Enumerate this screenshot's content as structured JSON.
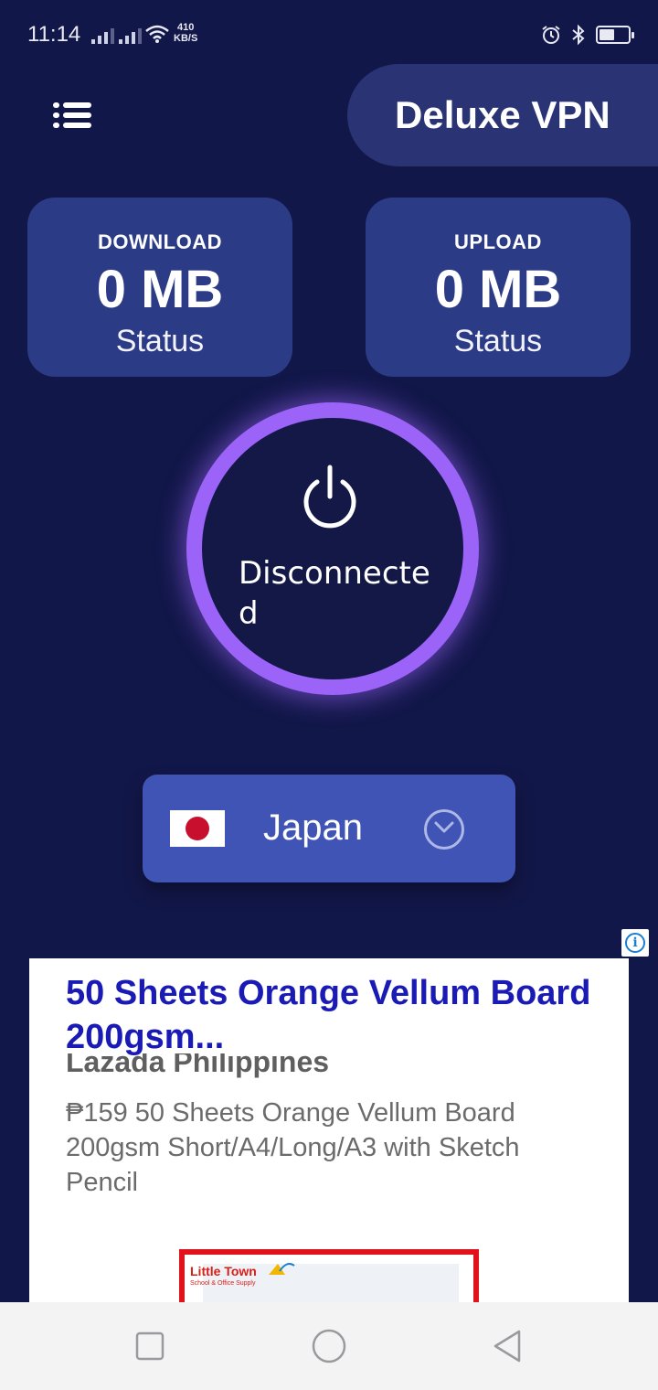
{
  "status_bar": {
    "time": "11:14",
    "net_speed_value": "410",
    "net_speed_unit": "KB/S",
    "icons": [
      "signal-icon",
      "signal-icon",
      "wifi-icon",
      "alarm-icon",
      "bluetooth-icon",
      "battery-icon"
    ],
    "battery_level": 0.45
  },
  "header": {
    "menu_icon": "list-menu-icon",
    "app_title": "Deluxe VPN"
  },
  "stats": {
    "download": {
      "label": "DOWNLOAD",
      "value": "0 MB",
      "status": "Status"
    },
    "upload": {
      "label": "UPLOAD",
      "value": "0 MB",
      "status": "Status"
    }
  },
  "connection": {
    "icon": "power-icon",
    "state": "Disconnected",
    "ring_color": "#9b63f8"
  },
  "server": {
    "flag": "japan-flag-icon",
    "country": "Japan",
    "dropdown_icon": "chevron-down-icon"
  },
  "ad": {
    "info_icon": "info-icon",
    "headline": "50 Sheets Orange Vellum Board 200gsm...",
    "source": "Lazada Philippines",
    "description": "₱159 50 Sheets Orange Vellum Board 200gsm Short/A4/Long/A3 with Sketch Pencil",
    "image_brand": "Little Town",
    "image_brand_sub": "School & Office Supply"
  },
  "nav_bar": {
    "recents_icon": "square-recents-icon",
    "home_icon": "circle-home-icon",
    "back_icon": "triangle-back-icon"
  },
  "colors": {
    "background": "#121749",
    "card": "#2c3b86",
    "selector": "#3f54b5",
    "accent": "#9b63f8",
    "ad_headline": "#1a1ab5"
  }
}
